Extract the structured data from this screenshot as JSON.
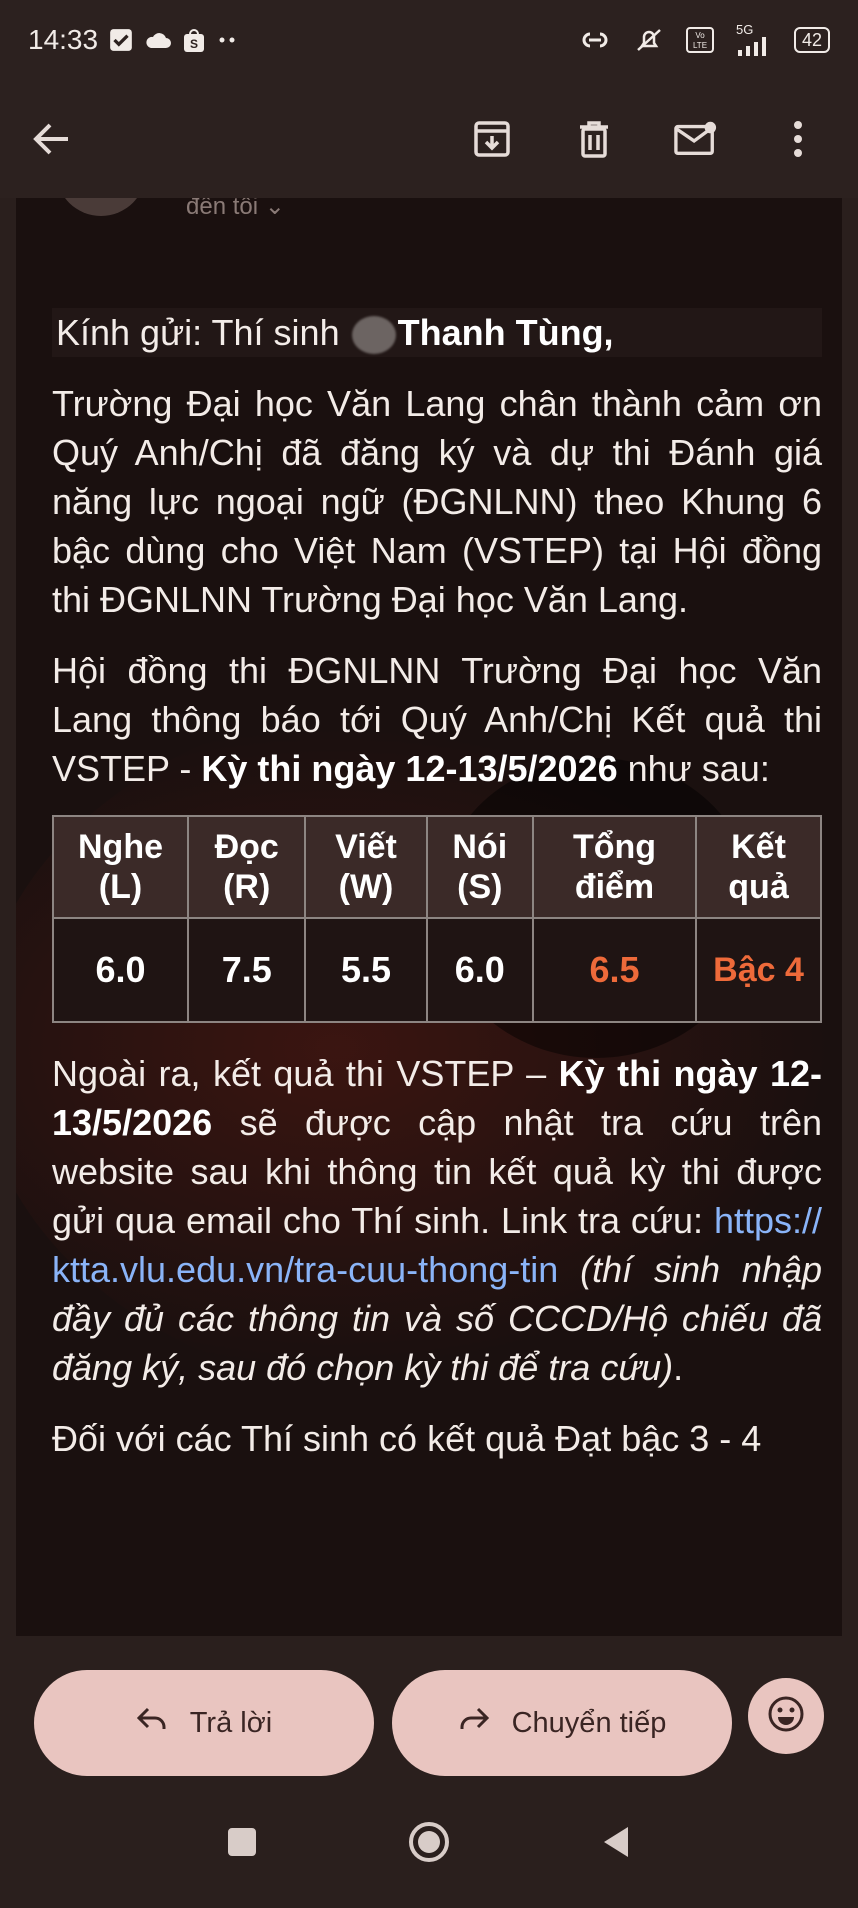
{
  "status_bar": {
    "time": "14:33",
    "network": "5G",
    "battery": "42",
    "icons": [
      "check-box-icon",
      "cloud-icon",
      "shopee-icon",
      "more-dots-icon",
      "link-icon",
      "mute-icon",
      "volte-icon",
      "signal-icon",
      "battery-icon"
    ]
  },
  "app_bar": {
    "icons": [
      "back-arrow-icon",
      "archive-icon",
      "delete-icon",
      "mark-unread-icon",
      "more-vert-icon"
    ]
  },
  "email": {
    "sender_snippet": "đến tôi ⌄",
    "greeting_prefix": "Kính gửi: Thí sinh",
    "greeting_name": "Thanh Tùng,",
    "para1": "Trường Đại học Văn Lang chân thành cảm ơn Quý Anh/Chị đã đăng ký và dự thi Đánh giá năng lực ngoại ngữ (ĐGNLNN) theo Khung 6 bậc dùng cho Việt Nam (VSTEP) tại Hội đồng thi ĐGNLNN Trường Đại học Văn Lang.",
    "para2_start": "Hội đồng thi ĐGNLNN Trường Đại học Văn Lang thông báo tới Quý Anh/Chị Kết quả thi VSTEP -",
    "para2_bold": "Kỳ thi ngày 12-13/5/2026",
    "para2_end": "như sau:",
    "table": {
      "headers": [
        "Nghe (L)",
        "Đọc (R)",
        "Viết (W)",
        "Nói (S)",
        "Tổng điểm",
        "Kết quả"
      ],
      "values": [
        "6.0",
        "7.5",
        "5.5",
        "6.0",
        "6.5",
        "Bậc 4"
      ]
    },
    "para3_start": "Ngoài ra, kết quả thi VSTEP –",
    "para3_bold": "Kỳ thi ngày 12-13/5/2026",
    "para3_mid": "sẽ được cập nhật tra cứu trên website sau khi thông tin kết quả kỳ thi được gửi qua email cho Thí sinh. Link tra cứu:",
    "para3_link": "https://ktta.vlu.edu.vn/tra-cuu-thong-tin",
    "para3_italic": "(thí sinh nhập đầy đủ các thông tin và số CCCD/Hộ chiếu đã đăng ký, sau đó chọn kỳ thi để tra cứu)",
    "para3_end": ".",
    "para4_partial": "Đối với các Thí sinh có kết quả Đạt bậc 3 - 4"
  },
  "bottom_bar": {
    "reply_label": "Trả lời",
    "forward_label": "Chuyển tiếp"
  },
  "colors": {
    "accent_result": "#ee6a3a",
    "link": "#8ab4f8",
    "pill": "#e9c5c0"
  }
}
